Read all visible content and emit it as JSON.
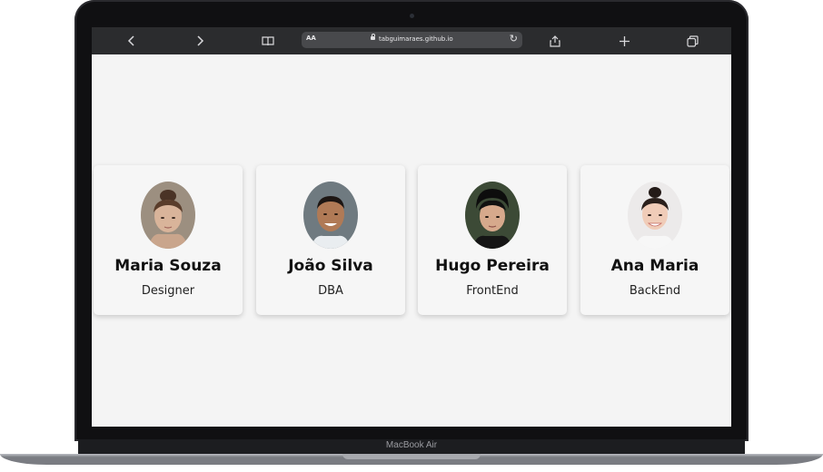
{
  "device": {
    "label": "MacBook Air"
  },
  "browser": {
    "text_size_label": "AA",
    "url": "tabguimaraes.github.io",
    "icons": [
      "chevron-left-icon",
      "chevron-right-icon",
      "book-icon",
      "reload-icon",
      "share-icon",
      "plus-icon",
      "tabs-icon"
    ]
  },
  "cards": [
    {
      "name": "Maria Souza",
      "role": "Designer"
    },
    {
      "name": "João Silva",
      "role": "DBA"
    },
    {
      "name": "Hugo Pereira",
      "role": "FrontEnd"
    },
    {
      "name": "Ana Maria",
      "role": "BackEnd"
    }
  ],
  "colors": {
    "page_background": "#f4f4f4",
    "card_background": "#f6f6f6",
    "toolbar": "#2b2c2e"
  }
}
